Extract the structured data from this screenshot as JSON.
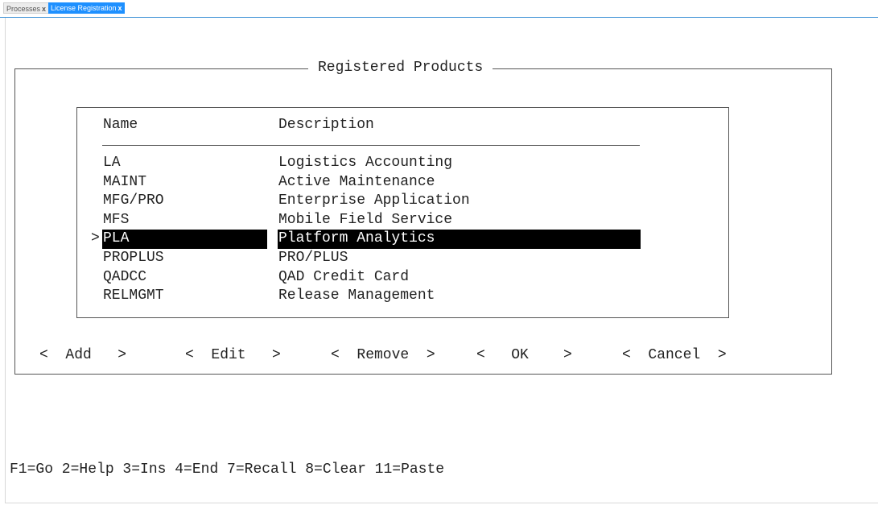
{
  "tabs": [
    {
      "label": "Processes",
      "close": "x"
    },
    {
      "label": "License Registration",
      "close": "x"
    }
  ],
  "dialog": {
    "title": "Registered Products",
    "columns": {
      "name": "Name",
      "description": "Description"
    },
    "selection_marker": ">",
    "rows": [
      {
        "name": "LA",
        "description": "Logistics Accounting"
      },
      {
        "name": "MAINT",
        "description": "Active Maintenance"
      },
      {
        "name": "MFG/PRO",
        "description": "Enterprise Application"
      },
      {
        "name": "MFS",
        "description": "Mobile Field Service"
      },
      {
        "name": "PLA",
        "description": "Platform Analytics"
      },
      {
        "name": "PROPLUS",
        "description": "PRO/PLUS"
      },
      {
        "name": "QADCC",
        "description": "QAD Credit Card"
      },
      {
        "name": "RELMGMT",
        "description": "Release Management"
      }
    ],
    "selected_row": "PLA",
    "buttons": {
      "add": "<  Add   >",
      "edit": "<  Edit   >",
      "remove": "<  Remove  >",
      "ok": "<   OK    >",
      "cancel": "<  Cancel  >"
    }
  },
  "function_keys": "F1=Go 2=Help 3=Ins 4=End 7=Recall 8=Clear 11=Paste",
  "colors": {
    "tab_active": "#1e90ff",
    "selection_bg": "#000000",
    "selection_fg": "#ffffff"
  }
}
